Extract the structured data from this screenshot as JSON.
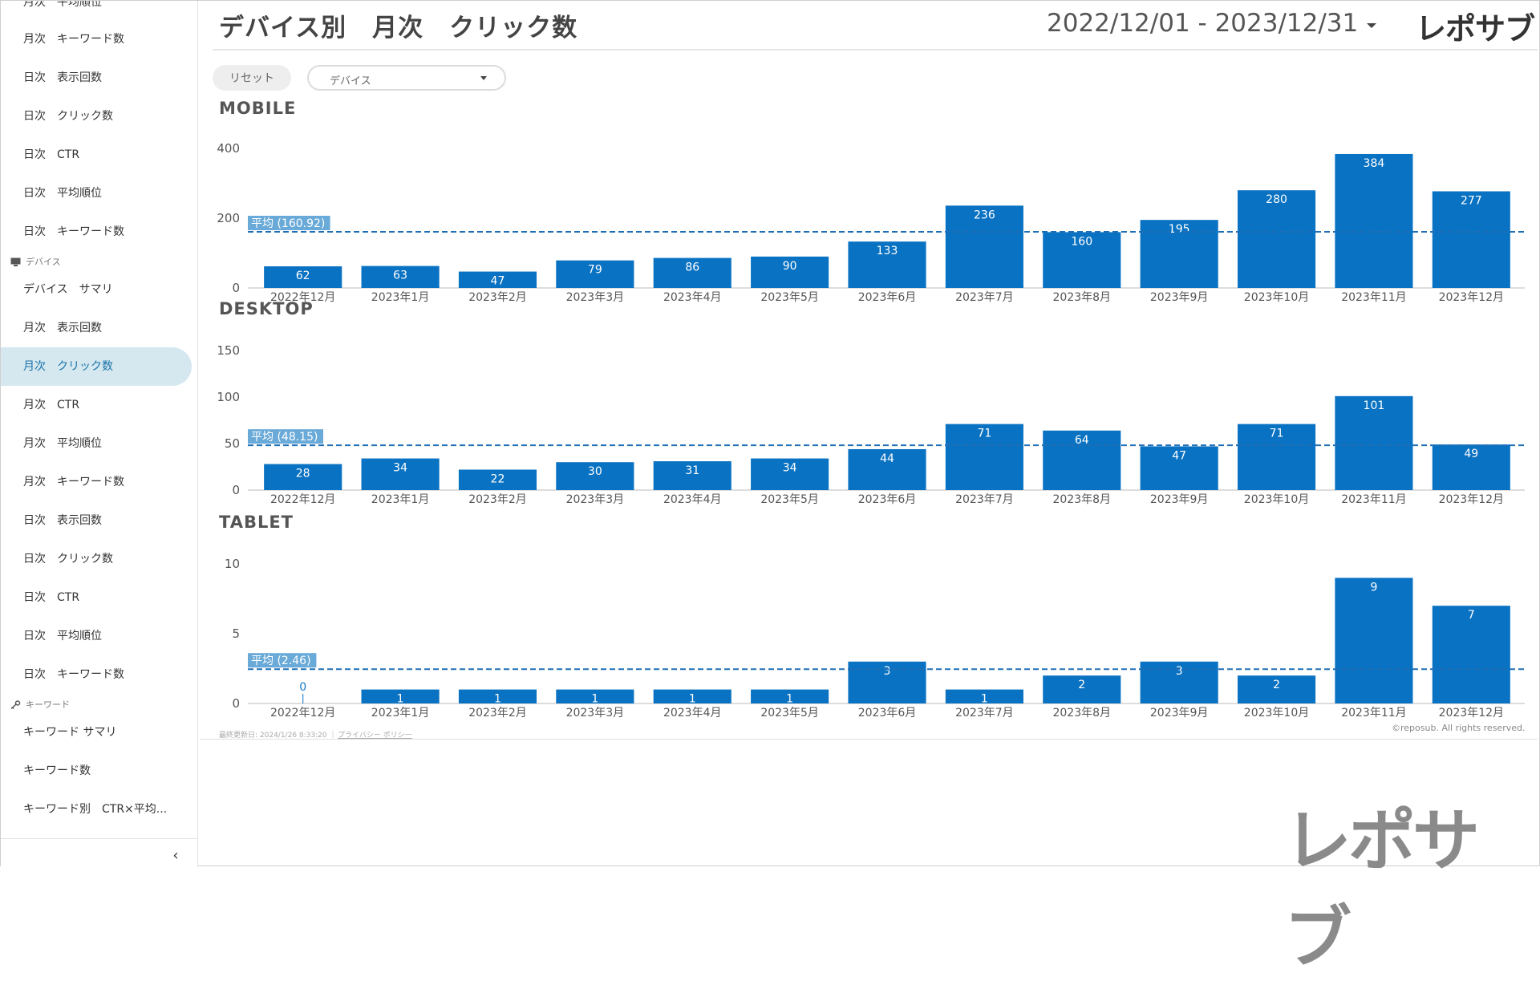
{
  "sidebar": {
    "top_cut_item": "月次　平均順位",
    "items_a": [
      {
        "label": "月次　キーワード数"
      },
      {
        "label": "日次　表示回数"
      },
      {
        "label": "日次　クリック数"
      },
      {
        "label": "日次　CTR"
      },
      {
        "label": "日次　平均順位"
      },
      {
        "label": "日次　キーワード数"
      }
    ],
    "section_device": "デバイス",
    "items_device": [
      {
        "label": "デバイス　サマリ"
      },
      {
        "label": "月次　表示回数"
      },
      {
        "label": "月次　クリック数"
      },
      {
        "label": "月次　CTR"
      },
      {
        "label": "月次　平均順位"
      },
      {
        "label": "月次　キーワード数"
      },
      {
        "label": "日次　表示回数"
      },
      {
        "label": "日次　クリック数"
      },
      {
        "label": "日次　CTR"
      },
      {
        "label": "日次　平均順位"
      },
      {
        "label": "日次　キーワード数"
      }
    ],
    "section_keyword": "キーワード",
    "items_keyword": [
      {
        "label": "キーワード サマリ"
      },
      {
        "label": "キーワード数"
      },
      {
        "label": "キーワード別　CTR×平均..."
      }
    ],
    "collapse_icon": "‹"
  },
  "header": {
    "title": "デバイス別　月次　クリック数",
    "date_range": "2022/12/01 - 2023/12/31",
    "logo": "レポサブ"
  },
  "filters": {
    "reset_label": "リセット",
    "device_label": "デバイス"
  },
  "footer": {
    "last_updated": "最終更新日: 2024/1/26 8:33:20 ｜",
    "privacy": "プライバシー ポリシー",
    "copyright": "©reposub. All rights reserved.",
    "logo": "レポサブ"
  },
  "colors": {
    "bar": "#0a72c2",
    "avg_line": "#1f6fb6",
    "avg_label_bg": "#6aaad8",
    "active_nav_bg": "#d5e8f0"
  },
  "chart_data": [
    {
      "type": "bar",
      "title": "MOBILE",
      "categories": [
        "2022年12月",
        "2023年1月",
        "2023年2月",
        "2023年3月",
        "2023年4月",
        "2023年5月",
        "2023年6月",
        "2023年7月",
        "2023年8月",
        "2023年9月",
        "2023年10月",
        "2023年11月",
        "2023年12月"
      ],
      "values": [
        62,
        63,
        47,
        79,
        86,
        90,
        133,
        236,
        160,
        195,
        280,
        384,
        277
      ],
      "yticks": [
        0,
        200,
        400
      ],
      "ylim": [
        0,
        400
      ],
      "average": 160.92,
      "average_label": "平均 (160.92)"
    },
    {
      "type": "bar",
      "title": "DESKTOP",
      "categories": [
        "2022年12月",
        "2023年1月",
        "2023年2月",
        "2023年3月",
        "2023年4月",
        "2023年5月",
        "2023年6月",
        "2023年7月",
        "2023年8月",
        "2023年9月",
        "2023年10月",
        "2023年11月",
        "2023年12月"
      ],
      "values": [
        28,
        34,
        22,
        30,
        31,
        34,
        44,
        71,
        64,
        47,
        71,
        101,
        49
      ],
      "yticks": [
        0,
        50,
        100,
        150
      ],
      "ylim": [
        0,
        150
      ],
      "average": 48.15,
      "average_label": "平均 (48.15)"
    },
    {
      "type": "bar",
      "title": "TABLET",
      "categories": [
        "2022年12月",
        "2023年1月",
        "2023年2月",
        "2023年3月",
        "2023年4月",
        "2023年5月",
        "2023年6月",
        "2023年7月",
        "2023年8月",
        "2023年9月",
        "2023年10月",
        "2023年11月",
        "2023年12月"
      ],
      "values": [
        0,
        1,
        1,
        1,
        1,
        1,
        3,
        1,
        2,
        3,
        2,
        9,
        7
      ],
      "yticks": [
        0,
        5,
        10
      ],
      "ylim": [
        0,
        10
      ],
      "average": 2.46,
      "average_label": "平均 (2.46)"
    }
  ]
}
